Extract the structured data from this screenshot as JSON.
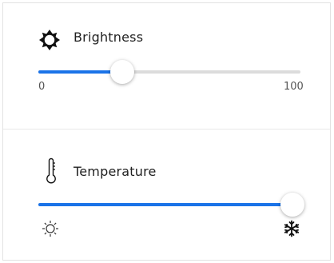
{
  "brightness": {
    "title": "Brightness",
    "icon": "brightness-gear-icon",
    "min_label": "0",
    "max_label": "100",
    "min": 0,
    "max": 100,
    "value": 32
  },
  "temperature": {
    "title": "Temperature",
    "icon": "thermometer-icon",
    "min_icon": "sun-icon",
    "max_icon": "snowflake-icon",
    "value_fraction": 1.0
  },
  "colors": {
    "accent": "#1a73e8",
    "track": "#dcdcdc",
    "divider": "#e8e8e8"
  }
}
